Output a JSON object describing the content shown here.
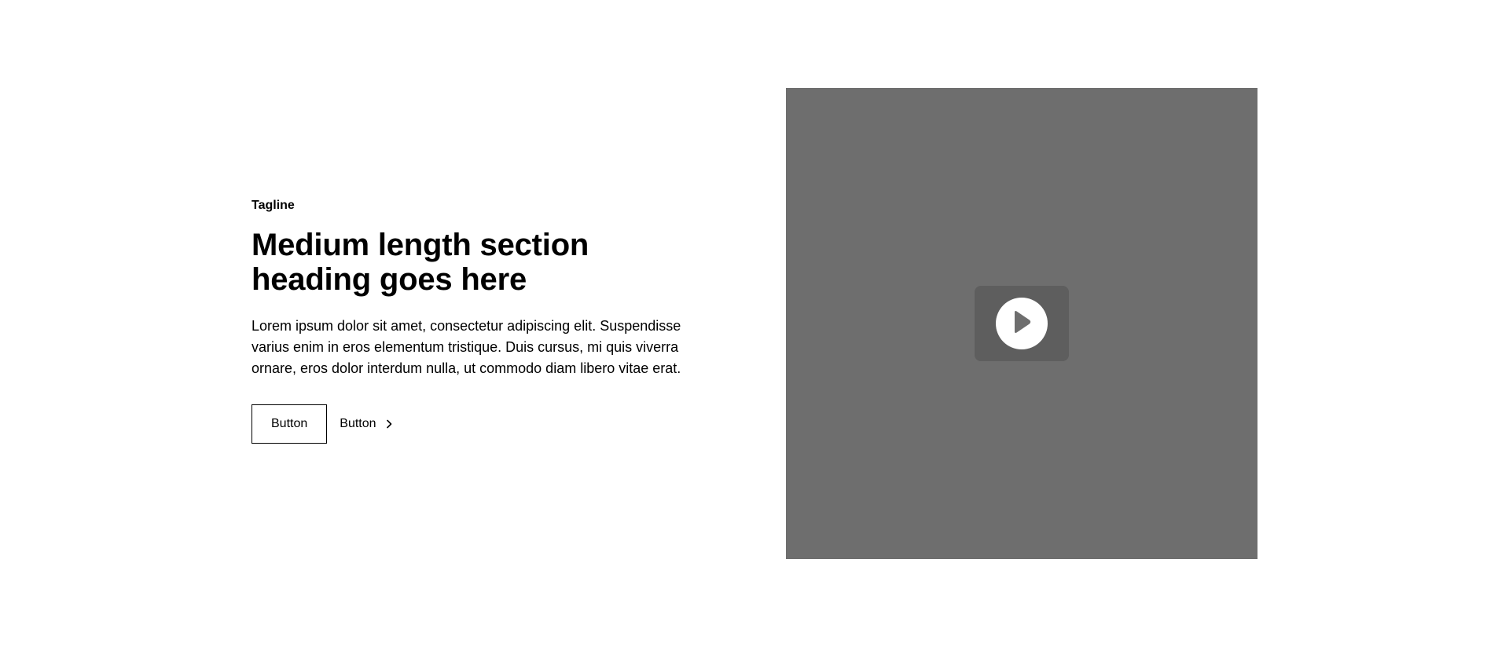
{
  "section": {
    "tagline": "Tagline",
    "heading": "Medium length section heading goes here",
    "body": "Lorem ipsum dolor sit amet, consectetur adipiscing elit. Suspendisse varius enim in eros elementum tristique. Duis cursus, mi quis viverra ornare, eros dolor interdum nulla, ut commodo diam libero vitae erat.",
    "primary_button_label": "Button",
    "secondary_button_label": "Button",
    "secondary_button_icon": "chevron-right-icon"
  },
  "media": {
    "type": "video-placeholder",
    "play_icon": "play-icon",
    "background_color": "#6e6e6e",
    "play_button_bg": "#5e5e5e"
  },
  "colors": {
    "text": "#000000",
    "page_background": "#ffffff"
  }
}
